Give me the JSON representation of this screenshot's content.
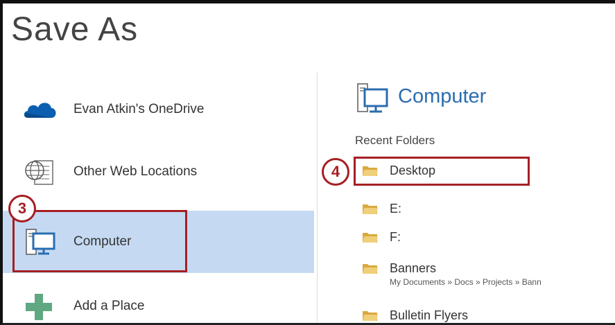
{
  "window": {
    "title": "Save As"
  },
  "places": [
    {
      "label": "Evan Atkin's OneDrive",
      "icon": "onedrive-cloud-icon",
      "selected": false
    },
    {
      "label": "Other Web Locations",
      "icon": "globe-document-icon",
      "selected": false
    },
    {
      "label": "Computer",
      "icon": "computer-monitor-icon",
      "selected": true
    },
    {
      "label": "Add a Place",
      "icon": "plus-icon",
      "selected": false
    }
  ],
  "location_panel": {
    "header": "Computer",
    "header_icon": "computer-monitor-icon",
    "section_label": "Recent Folders",
    "folders": [
      {
        "name": "Desktop",
        "path": ""
      },
      {
        "name": "E:",
        "path": ""
      },
      {
        "name": "F:",
        "path": ""
      },
      {
        "name": "Banners",
        "path": "My Documents » Docs » Projects » Bann"
      },
      {
        "name": "Bulletin Flyers",
        "path": ""
      }
    ]
  },
  "annotations": {
    "step_3": "3",
    "step_4": "4"
  },
  "colors": {
    "selected_background": "#c5daf2",
    "accent_blue": "#2b6cb0",
    "annotation_red": "#a51f24",
    "folder_yellow": "#e8c46a"
  }
}
